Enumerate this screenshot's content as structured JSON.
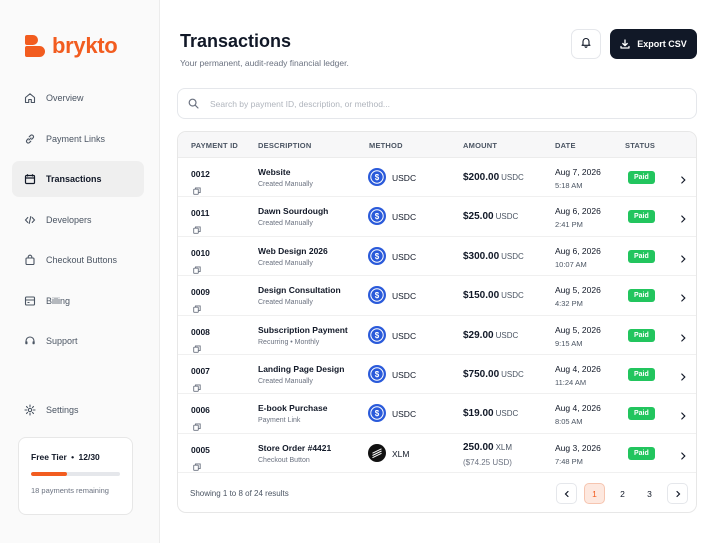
{
  "brand": {
    "name": "brykto",
    "accent": "#f25c1f"
  },
  "sidebar": {
    "items": [
      {
        "label": "Overview",
        "icon": "home-icon",
        "active": false
      },
      {
        "label": "Payment Links",
        "icon": "link-icon",
        "active": false
      },
      {
        "label": "Transactions",
        "icon": "receipt-icon",
        "active": true
      },
      {
        "label": "Developers",
        "icon": "code-icon",
        "active": false
      },
      {
        "label": "Checkout Buttons",
        "icon": "shopping-bag-icon",
        "active": false
      },
      {
        "label": "Billing",
        "icon": "billing-icon",
        "active": false
      },
      {
        "label": "Support",
        "icon": "headset-icon",
        "active": false
      }
    ],
    "settings_label": "Settings",
    "tier": {
      "title": "Free Tier",
      "separator": "•",
      "usage": "12/30",
      "used_fraction": 0.4,
      "remaining": "18 payments remaining"
    }
  },
  "header": {
    "title": "Transactions",
    "subtitle": "Your permanent, audit-ready financial ledger.",
    "export_label": "Export CSV"
  },
  "search": {
    "placeholder": "Search by payment ID, description, or method..."
  },
  "table": {
    "columns": [
      "PAYMENT ID",
      "DESCRIPTION",
      "METHOD",
      "AMOUNT",
      "DATE",
      "STATUS"
    ],
    "rows": [
      {
        "id": "0012",
        "description": "Website",
        "sub": "Created Manually",
        "method": "USDC",
        "amount": "$200.00",
        "currency": "USDC",
        "date": "Aug 7, 2026",
        "time": "5:18 AM",
        "status": "Paid"
      },
      {
        "id": "0011",
        "description": "Dawn Sourdough",
        "sub": "Created Manually",
        "method": "USDC",
        "amount": "$25.00",
        "currency": "USDC",
        "date": "Aug 6, 2026",
        "time": "2:41 PM",
        "status": "Paid"
      },
      {
        "id": "0010",
        "description": "Web Design 2026",
        "sub": "Created Manually",
        "method": "USDC",
        "amount": "$300.00",
        "currency": "USDC",
        "date": "Aug 6, 2026",
        "time": "10:07 AM",
        "status": "Paid"
      },
      {
        "id": "0009",
        "description": "Design Consultation",
        "sub": "Created Manually",
        "method": "USDC",
        "amount": "$150.00",
        "currency": "USDC",
        "date": "Aug 5, 2026",
        "time": "4:32 PM",
        "status": "Paid"
      },
      {
        "id": "0008",
        "description": "Subscription Payment",
        "sub": "Recurring • Monthly",
        "method": "USDC",
        "amount": "$29.00",
        "currency": "USDC",
        "date": "Aug 5, 2026",
        "time": "9:15 AM",
        "status": "Paid"
      },
      {
        "id": "0007",
        "description": "Landing Page Design",
        "sub": "Created Manually",
        "method": "USDC",
        "amount": "$750.00",
        "currency": "USDC",
        "date": "Aug 4, 2026",
        "time": "11:24 AM",
        "status": "Paid"
      },
      {
        "id": "0006",
        "description": "E-book Purchase",
        "sub": "Payment Link",
        "method": "USDC",
        "amount": "$19.00",
        "currency": "USDC",
        "date": "Aug 4, 2026",
        "time": "8:05 AM",
        "status": "Paid"
      },
      {
        "id": "0005",
        "description": "Store Order #4421",
        "sub": "Checkout Button",
        "method": "XLM",
        "amount": "250.00",
        "currency": "XLM",
        "amount_sub": "($74.25 USD)",
        "date": "Aug 3, 2026",
        "time": "7:48 PM",
        "status": "Paid"
      }
    ],
    "footer": {
      "showing": "Showing 1 to 8 of 24 results",
      "pages": [
        "1",
        "2",
        "3"
      ],
      "current_page": "1"
    }
  },
  "colors": {
    "paid": "#22c55e",
    "usdc": "#2a5ada",
    "dark_button": "#111827"
  }
}
